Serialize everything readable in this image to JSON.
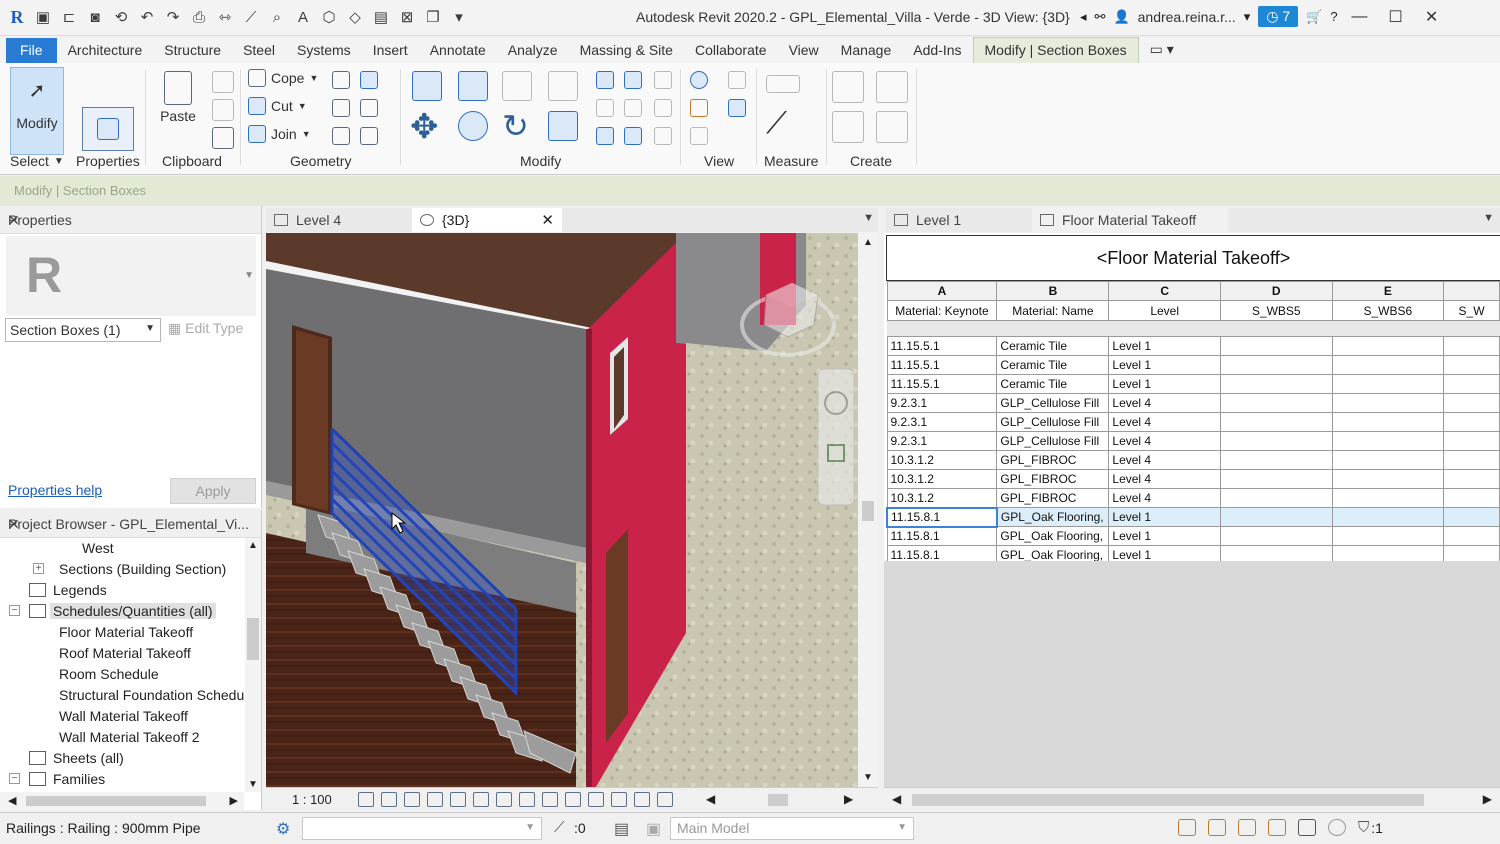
{
  "window": {
    "title": "Autodesk Revit 2020.2 - GPL_Elemental_Villa - Verde - 3D View: {3D}",
    "user": "andrea.reina.r...",
    "notifications": "7"
  },
  "ribbon": {
    "tabs": [
      "File",
      "Architecture",
      "Structure",
      "Steel",
      "Systems",
      "Insert",
      "Annotate",
      "Analyze",
      "Massing & Site",
      "Collaborate",
      "View",
      "Manage",
      "Add-Ins",
      "Modify | Section Boxes"
    ],
    "modify_label": "Modify",
    "select_label": "Select",
    "properties_label": "Properties",
    "paste_label": "Paste",
    "clipboard_label": "Clipboard",
    "cope_label": "Cope",
    "cut_label": "Cut",
    "join_label": "Join",
    "geometry_label": "Geometry",
    "modify_panel_label": "Modify",
    "view_label": "View",
    "measure_label": "Measure",
    "create_label": "Create",
    "context_label": "Modify | Section Boxes"
  },
  "properties": {
    "header": "Properties",
    "type_selector": "Section Boxes (1)",
    "edit_type": "Edit Type",
    "help_link": "Properties help",
    "apply": "Apply"
  },
  "browser": {
    "header": "Project Browser - GPL_Elemental_Vi...",
    "items": [
      {
        "label": "West",
        "indent": 82,
        "icon": false,
        "expander": ""
      },
      {
        "label": "Sections (Building Section)",
        "indent": 59,
        "icon": false,
        "expander": "+"
      },
      {
        "label": "Legends",
        "indent": 53,
        "icon": true,
        "expander": ""
      },
      {
        "label": "Schedules/Quantities (all)",
        "indent": 53,
        "icon": true,
        "expander": "-",
        "selected": true
      },
      {
        "label": "Floor Material Takeoff",
        "indent": 59,
        "icon": false,
        "expander": ""
      },
      {
        "label": "Roof Material Takeoff",
        "indent": 59,
        "icon": false,
        "expander": ""
      },
      {
        "label": "Room Schedule",
        "indent": 59,
        "icon": false,
        "expander": ""
      },
      {
        "label": "Structural Foundation Schedule",
        "indent": 59,
        "icon": false,
        "expander": ""
      },
      {
        "label": "Wall Material Takeoff",
        "indent": 59,
        "icon": false,
        "expander": ""
      },
      {
        "label": "Wall Material Takeoff 2",
        "indent": 59,
        "icon": false,
        "expander": ""
      },
      {
        "label": "Sheets (all)",
        "indent": 53,
        "icon": true,
        "expander": ""
      },
      {
        "label": "Families",
        "indent": 53,
        "icon": true,
        "expander": "-"
      }
    ]
  },
  "view_tabs_left": [
    {
      "label": "Level 4",
      "active": false
    },
    {
      "label": "{3D}",
      "active": true
    }
  ],
  "view_tabs_right": [
    {
      "label": "Level 1",
      "active": false
    },
    {
      "label": "Floor Material Takeoff",
      "active": true
    }
  ],
  "view_scale": "1 : 100",
  "schedule": {
    "title": "<Floor Material Takeoff>",
    "letters": [
      "A",
      "B",
      "C",
      "D",
      "E",
      ""
    ],
    "headers": [
      "Material: Keynote",
      "Material: Name",
      "Level",
      "S_WBS5",
      "S_WBS6",
      "S_W"
    ],
    "rows": [
      [
        "11.15.5.1",
        "Ceramic Tile",
        "Level 1"
      ],
      [
        "11.15.5.1",
        "Ceramic Tile",
        "Level 1"
      ],
      [
        "11.15.5.1",
        "Ceramic Tile",
        "Level 1"
      ],
      [
        "9.2.3.1",
        "GLP_Cellulose Fill",
        "Level 4"
      ],
      [
        "9.2.3.1",
        "GLP_Cellulose Fill",
        "Level 4"
      ],
      [
        "9.2.3.1",
        "GLP_Cellulose Fill",
        "Level 4"
      ],
      [
        "10.3.1.2",
        "GPL_FIBROC",
        "Level 4"
      ],
      [
        "10.3.1.2",
        "GPL_FIBROC",
        "Level 4"
      ],
      [
        "10.3.1.2",
        "GPL_FIBROC",
        "Level 4"
      ],
      [
        "11.15.8.1",
        "GPL_Oak Flooring,",
        "Level 1"
      ],
      [
        "11.15.8.1",
        "GPL_Oak Flooring,",
        "Level 1"
      ],
      [
        "11.15.8.1",
        "GPL_Oak Flooring,",
        "Level 1"
      ]
    ],
    "selected_row": 9
  },
  "statusbar": {
    "text": "Railings : Railing : 900mm Pipe",
    "zero_label": ":0",
    "model": "Main Model",
    "filter_count": ":1"
  },
  "colors": {
    "accent": "#2a7bd4",
    "context_tab": "#e5ecdb",
    "railing": "#1e3fb0",
    "wall_red": "#c9234a"
  }
}
